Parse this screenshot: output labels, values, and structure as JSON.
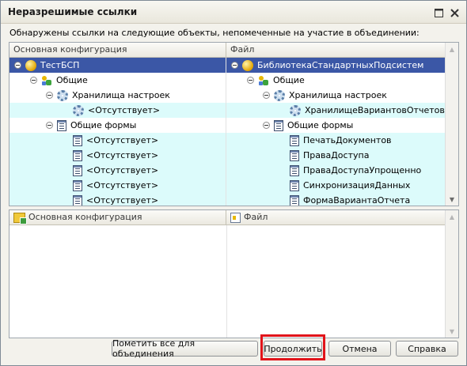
{
  "window": {
    "title": "Неразрешимые ссылки",
    "message": "Обнаружены ссылки на следующие  объекты, непомеченные на участие в объединении:"
  },
  "top_table": {
    "columns": [
      "Основная конфигурация",
      "Файл"
    ],
    "rows": [
      {
        "left": "ТестБСП",
        "right": "БиблиотекаСтандартныхПодсистем",
        "selected": true
      },
      {
        "left": "Общие",
        "right": "Общие"
      },
      {
        "left": "Хранилища настроек",
        "right": "Хранилища настроек"
      },
      {
        "left": "<Отсутствует>",
        "right": "ХранилищеВариантовОтчетов",
        "highlight": true
      },
      {
        "left": "Общие формы",
        "right": "Общие формы"
      },
      {
        "left": "<Отсутствует>",
        "right": "ПечатьДокументов",
        "highlight": true
      },
      {
        "left": "<Отсутствует>",
        "right": "ПраваДоступа",
        "highlight": true
      },
      {
        "left": "<Отсутствует>",
        "right": "ПраваДоступаУпрощенно",
        "highlight": true
      },
      {
        "left": "<Отсутствует>",
        "right": "СинхронизацияДанных",
        "highlight": true
      },
      {
        "left": "<Отсутствует>",
        "right": "ФормаВариантаОтчета",
        "highlight": true
      }
    ]
  },
  "bottom_table": {
    "columns": [
      "Основная конфигурация",
      "Файл"
    ]
  },
  "buttons": {
    "mark_all": "Пометить все для объединения",
    "continue": "Продолжить",
    "cancel": "Отмена",
    "help": "Справка"
  },
  "colors": {
    "selection": "#3b57a6",
    "highlight_row": "#dcfbfb",
    "callout": "#e1141a"
  }
}
